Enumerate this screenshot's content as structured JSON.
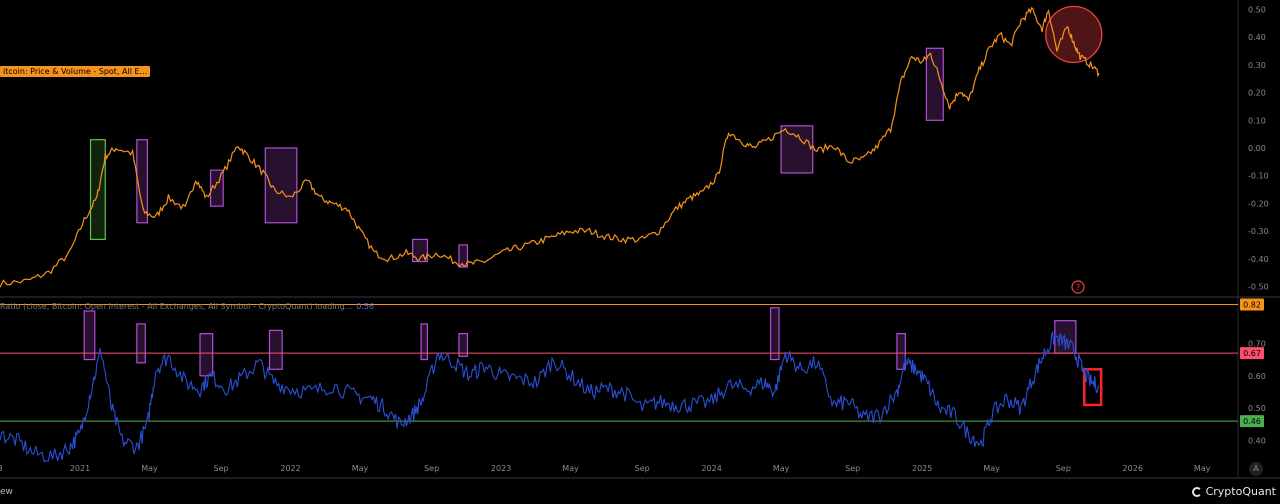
{
  "labels": {
    "main_series": "itcoin: Price & Volume - Spot, All E...",
    "indicator": "Ratio (close, Bitcoin: Open Interest - All Exchanges, All Symbol - CryptoQuant) loading...",
    "indicator_value": "0.56",
    "footer_left": "ew",
    "brand": "CryptoQuant",
    "auto_button": "A",
    "help_marker": "?"
  },
  "colors": {
    "price_line": "#f7931a",
    "ratio_line": "#2a4fd6",
    "upper_band": "#f7931a",
    "mid_band": "#ff4d6d",
    "lower_band": "#4caf50",
    "box_purple": "#b14ed6",
    "box_green": "#5ec44a",
    "box_red": "#ff2222"
  },
  "chart_data": [
    {
      "type": "line",
      "name": "main-price-pane",
      "y_axis_ticks": [
        "0.50",
        "0.40",
        "0.30",
        "0.20",
        "0.10",
        "0.00",
        "-0.10",
        "-0.20",
        "-0.30",
        "-0.40",
        "-0.50"
      ],
      "ylim": [
        -0.52,
        0.52
      ],
      "x": [
        2020.62,
        2020.75,
        2020.85,
        2020.95,
        2021.02,
        2021.08,
        2021.12,
        2021.17,
        2021.25,
        2021.3,
        2021.36,
        2021.42,
        2021.5,
        2021.55,
        2021.6,
        2021.68,
        2021.75,
        2021.8,
        2021.87,
        2021.92,
        2022.0,
        2022.08,
        2022.14,
        2022.2,
        2022.27,
        2022.33,
        2022.4,
        2022.47,
        2022.55,
        2022.62,
        2022.7,
        2022.78,
        2022.85,
        2022.92,
        2023.0,
        2023.08,
        2023.17,
        2023.25,
        2023.33,
        2023.42,
        2023.5,
        2023.58,
        2023.67,
        2023.75,
        2023.83,
        2023.9,
        2023.96,
        2024.03,
        2024.08,
        2024.15,
        2024.2,
        2024.27,
        2024.35,
        2024.42,
        2024.5,
        2024.58,
        2024.65,
        2024.72,
        2024.78,
        2024.85,
        2024.9,
        2024.95,
        2025.0,
        2025.04,
        2025.08,
        2025.13,
        2025.18,
        2025.22,
        2025.27,
        2025.32,
        2025.37,
        2025.42,
        2025.47,
        2025.52,
        2025.57,
        2025.6,
        2025.64,
        2025.69,
        2025.72,
        2025.75,
        2025.8,
        2025.84
      ],
      "y": [
        -0.49,
        -0.48,
        -0.45,
        -0.38,
        -0.26,
        -0.18,
        -0.03,
        0.0,
        -0.02,
        -0.23,
        -0.25,
        -0.18,
        -0.22,
        -0.11,
        -0.18,
        -0.09,
        0.01,
        -0.03,
        -0.09,
        -0.15,
        -0.18,
        -0.12,
        -0.18,
        -0.2,
        -0.22,
        -0.3,
        -0.38,
        -0.4,
        -0.38,
        -0.4,
        -0.38,
        -0.41,
        -0.42,
        -0.41,
        -0.38,
        -0.36,
        -0.34,
        -0.32,
        -0.3,
        -0.3,
        -0.32,
        -0.33,
        -0.33,
        -0.3,
        -0.22,
        -0.18,
        -0.16,
        -0.1,
        0.06,
        0.02,
        0.0,
        0.03,
        0.07,
        0.04,
        -0.01,
        0.01,
        -0.05,
        -0.04,
        0.0,
        0.07,
        0.24,
        0.33,
        0.31,
        0.34,
        0.26,
        0.15,
        0.21,
        0.17,
        0.28,
        0.36,
        0.41,
        0.37,
        0.46,
        0.5,
        0.43,
        0.5,
        0.35,
        0.44,
        0.38,
        0.33,
        0.3,
        0.27
      ]
    },
    {
      "type": "line",
      "name": "oi-ratio-pane",
      "y_axis_ticks": [
        "0.70",
        "0.60",
        "0.50",
        "0.40"
      ],
      "ylim": [
        0.34,
        0.84
      ],
      "x_ticks": [
        "8",
        "2021",
        "May",
        "Sep",
        "2022",
        "May",
        "Sep",
        "2023",
        "May",
        "Sep",
        "2024",
        "May",
        "Sep",
        "2025",
        "May",
        "Sep",
        "2026",
        "May"
      ],
      "x_tick_positions": [
        2020.62,
        2021.0,
        2021.33,
        2021.67,
        2022.0,
        2022.33,
        2022.67,
        2023.0,
        2023.33,
        2023.67,
        2024.0,
        2024.33,
        2024.67,
        2025.0,
        2025.33,
        2025.67,
        2026.0,
        2026.33
      ],
      "reference_lines": [
        0.82,
        0.67,
        0.46
      ],
      "x": [
        2020.62,
        2020.7,
        2020.78,
        2020.88,
        2020.95,
        2021.0,
        2021.05,
        2021.1,
        2021.15,
        2021.2,
        2021.27,
        2021.32,
        2021.36,
        2021.42,
        2021.5,
        2021.57,
        2021.62,
        2021.7,
        2021.78,
        2021.85,
        2021.92,
        2022.0,
        2022.1,
        2022.2,
        2022.3,
        2022.38,
        2022.45,
        2022.52,
        2022.58,
        2022.63,
        2022.7,
        2022.78,
        2022.85,
        2022.92,
        2023.0,
        2023.08,
        2023.17,
        2023.25,
        2023.33,
        2023.42,
        2023.5,
        2023.58,
        2023.67,
        2023.75,
        2023.83,
        2023.9,
        2024.0,
        2024.08,
        2024.17,
        2024.25,
        2024.3,
        2024.35,
        2024.42,
        2024.5,
        2024.58,
        2024.65,
        2024.72,
        2024.8,
        2024.88,
        2024.92,
        2024.97,
        2025.02,
        2025.08,
        2025.15,
        2025.22,
        2025.28,
        2025.33,
        2025.4,
        2025.47,
        2025.53,
        2025.58,
        2025.63,
        2025.68,
        2025.72,
        2025.76,
        2025.8,
        2025.84
      ],
      "y": [
        0.42,
        0.4,
        0.36,
        0.35,
        0.38,
        0.42,
        0.55,
        0.68,
        0.5,
        0.4,
        0.38,
        0.45,
        0.62,
        0.66,
        0.58,
        0.56,
        0.6,
        0.56,
        0.6,
        0.64,
        0.58,
        0.56,
        0.55,
        0.57,
        0.54,
        0.53,
        0.5,
        0.45,
        0.48,
        0.53,
        0.67,
        0.64,
        0.6,
        0.63,
        0.6,
        0.59,
        0.58,
        0.65,
        0.6,
        0.55,
        0.56,
        0.55,
        0.5,
        0.52,
        0.51,
        0.51,
        0.52,
        0.57,
        0.56,
        0.58,
        0.55,
        0.67,
        0.62,
        0.64,
        0.51,
        0.52,
        0.47,
        0.48,
        0.55,
        0.64,
        0.62,
        0.58,
        0.5,
        0.48,
        0.42,
        0.39,
        0.48,
        0.53,
        0.5,
        0.6,
        0.67,
        0.72,
        0.7,
        0.68,
        0.62,
        0.58,
        0.57
      ]
    }
  ],
  "annotations": {
    "price_boxes": [
      {
        "color": "green",
        "x0": 2021.05,
        "x1": 2021.12,
        "y0": 0.03,
        "y1": -0.33
      },
      {
        "color": "purple",
        "x0": 2021.27,
        "x1": 2021.32,
        "y0": 0.03,
        "y1": -0.27
      },
      {
        "color": "purple",
        "x0": 2021.62,
        "x1": 2021.68,
        "y0": -0.08,
        "y1": -0.21
      },
      {
        "color": "purple",
        "x0": 2021.88,
        "x1": 2022.03,
        "y0": 0.0,
        "y1": -0.27
      },
      {
        "color": "purple",
        "x0": 2022.58,
        "x1": 2022.65,
        "y0": -0.33,
        "y1": -0.41
      },
      {
        "color": "purple",
        "x0": 2022.8,
        "x1": 2022.84,
        "y0": -0.35,
        "y1": -0.43
      },
      {
        "color": "purple",
        "x0": 2024.33,
        "x1": 2024.48,
        "y0": 0.08,
        "y1": -0.09
      },
      {
        "color": "purple",
        "x0": 2025.02,
        "x1": 2025.1,
        "y0": 0.36,
        "y1": 0.1
      }
    ],
    "price_circle": {
      "x": 2025.72,
      "y": 0.41
    },
    "ratio_boxes": [
      {
        "color": "purple",
        "x0": 2021.02,
        "x1": 2021.07,
        "y0": 0.8,
        "y1": 0.65
      },
      {
        "color": "purple",
        "x0": 2021.27,
        "x1": 2021.31,
        "y0": 0.76,
        "y1": 0.64
      },
      {
        "color": "purple",
        "x0": 2021.57,
        "x1": 2021.63,
        "y0": 0.73,
        "y1": 0.6
      },
      {
        "color": "purple",
        "x0": 2021.9,
        "x1": 2021.96,
        "y0": 0.74,
        "y1": 0.62
      },
      {
        "color": "purple",
        "x0": 2022.62,
        "x1": 2022.65,
        "y0": 0.76,
        "y1": 0.65
      },
      {
        "color": "purple",
        "x0": 2022.8,
        "x1": 2022.84,
        "y0": 0.73,
        "y1": 0.66
      },
      {
        "color": "purple",
        "x0": 2024.28,
        "x1": 2024.32,
        "y0": 0.81,
        "y1": 0.65
      },
      {
        "color": "purple",
        "x0": 2024.88,
        "x1": 2024.92,
        "y0": 0.73,
        "y1": 0.62
      },
      {
        "color": "purple",
        "x0": 2025.63,
        "x1": 2025.73,
        "y0": 0.77,
        "y1": 0.67
      }
    ],
    "ratio_highlight": {
      "x0": 2025.77,
      "x1": 2025.85,
      "y0": 0.62,
      "y1": 0.51
    }
  }
}
